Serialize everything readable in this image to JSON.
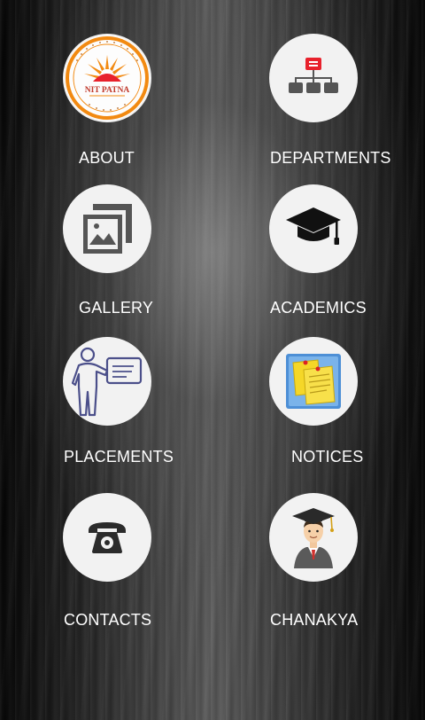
{
  "menu": {
    "items": [
      {
        "id": "about",
        "label": "ABOUT",
        "icon": "nit-patna-logo-icon"
      },
      {
        "id": "departments",
        "label": "DEPARTMENTS",
        "icon": "org-chart-icon"
      },
      {
        "id": "gallery",
        "label": "GALLERY",
        "icon": "image-gallery-icon"
      },
      {
        "id": "academics",
        "label": "ACADEMICS",
        "icon": "graduation-cap-icon"
      },
      {
        "id": "placements",
        "label": "PLACEMENTS",
        "icon": "presentation-icon"
      },
      {
        "id": "notices",
        "label": "NOTICES",
        "icon": "sticky-notes-icon"
      },
      {
        "id": "contacts",
        "label": "CONTACTS",
        "icon": "telephone-icon"
      },
      {
        "id": "chanakya",
        "label": "CHANAKYA",
        "icon": "graduate-student-icon"
      }
    ]
  },
  "logo": {
    "text": "NIT PATNA"
  },
  "colors": {
    "circle_bg": "#f2f2f2",
    "label_text": "#ffffff",
    "departments_top": "#e8212c",
    "departments_nodes": "#555555",
    "logo_orange": "#f28a12",
    "notes_yellow": "#f5d728",
    "notes_blue_bg": "#4d8fd6"
  }
}
